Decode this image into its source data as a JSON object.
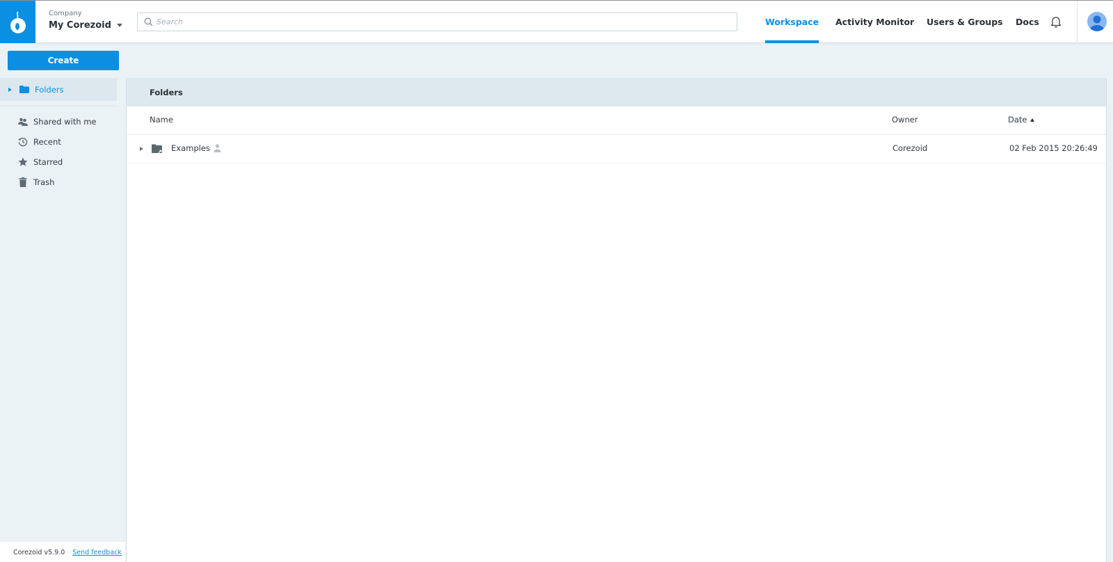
{
  "header": {
    "logo": "corezoid-logo-icon",
    "company_label": "Company",
    "company_name": "My Corezoid",
    "search_placeholder": "Search",
    "search_value": "",
    "nav": [
      {
        "label": "Workspace",
        "active": true
      },
      {
        "label": "Activity Monitor",
        "active": false
      },
      {
        "label": "Users & Groups",
        "active": false
      },
      {
        "label": "Docs",
        "active": false
      }
    ],
    "icons": {
      "notifications": "bell-icon",
      "profile": "user-avatar-icon"
    }
  },
  "sidebar": {
    "create_label": "Create",
    "folders_label": "Folders",
    "items": [
      {
        "label": "Shared with me",
        "icon": "shared-users-icon"
      },
      {
        "label": "Recent",
        "icon": "history-icon"
      },
      {
        "label": "Starred",
        "icon": "star-icon"
      },
      {
        "label": "Trash",
        "icon": "trash-icon"
      }
    ],
    "footer": {
      "version": "Corezoid v5.9.0",
      "feedback_link": "Send feedback"
    }
  },
  "main": {
    "title": "Folders",
    "columns": {
      "name": "Name",
      "owner": "Owner",
      "date": "Date",
      "date_sort": "ascending"
    },
    "rows": [
      {
        "name": "Examples",
        "owner": "Corezoid",
        "date": "02 Feb 2015 20:26:49",
        "shared": true
      }
    ]
  },
  "colors": {
    "accent": "#0b8fe2",
    "background": "#ebf2f6",
    "panel_header": "#dde9ef"
  }
}
